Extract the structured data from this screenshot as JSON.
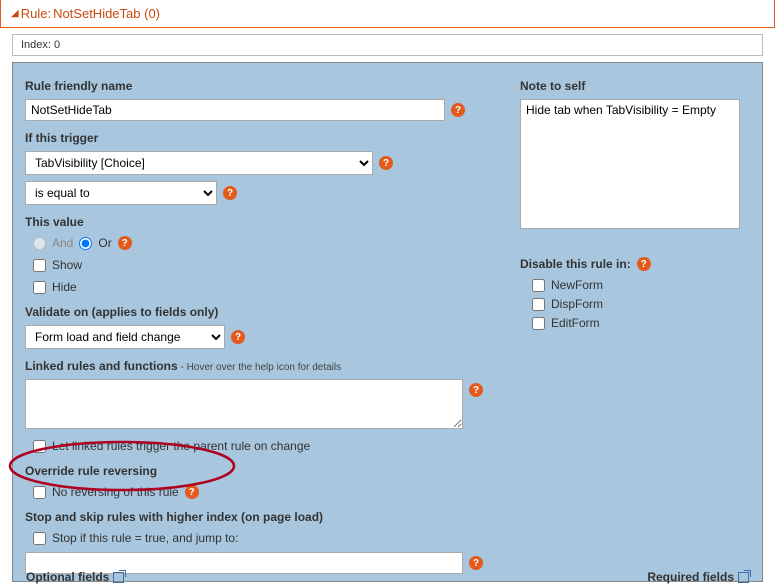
{
  "header": {
    "prefix": "Rule:",
    "name": "NotSetHideTab (0)"
  },
  "index_bar": "Index: 0",
  "left": {
    "friendly_label": "Rule friendly name",
    "friendly_value": "NotSetHideTab",
    "trigger_label": "If this trigger",
    "trigger_field": "TabVisibility [Choice]",
    "trigger_op": "is equal to",
    "value_label": "This value",
    "and": "And",
    "or": "Or",
    "show": "Show",
    "hide": "Hide",
    "validate_label": "Validate on (applies to fields only)",
    "validate_value": "Form load and field change",
    "linked_label": "Linked rules and functions",
    "linked_hint": " - Hover over the help icon for details",
    "linked_trigger": "Let linked rules trigger the parent rule on change",
    "override_label": "Override rule reversing",
    "override_check": "No reversing of this rule",
    "stop_label": "Stop and skip rules with higher index (on page load)",
    "stop_check": "Stop if this rule = true, and jump to:"
  },
  "right": {
    "note_label": "Note to self",
    "note_value": "Hide tab when TabVisibility = Empty",
    "disable_label": "Disable this rule in:",
    "newform": "NewForm",
    "dispform": "DispForm",
    "editform": "EditForm"
  },
  "bottom": {
    "optional": "Optional fields",
    "required": "Required fields"
  },
  "help": "?"
}
